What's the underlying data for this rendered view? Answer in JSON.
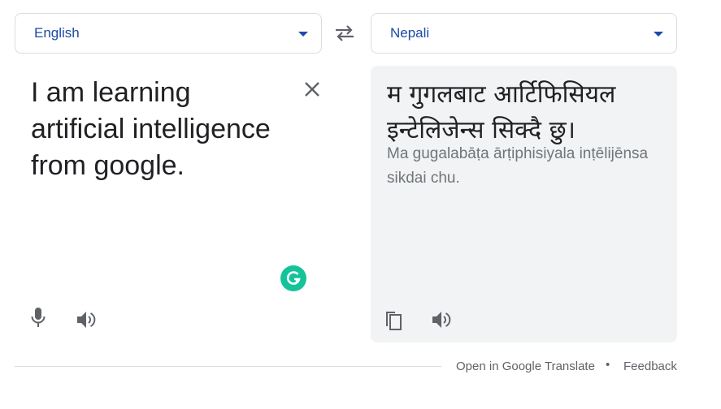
{
  "source": {
    "language": "English",
    "text": "I am learning artificial intelligence from google."
  },
  "target": {
    "language": "Nepali",
    "text": "म गुगलबाट आर्टिफिसियल इन्टेलिजेन्स सिक्दै छु।",
    "transliteration": "Ma gugalabāṭa ārṭiphisiyala inṭēlijēnsa sikdai chu."
  },
  "footer": {
    "open_link": "Open in Google Translate",
    "separator": "•",
    "feedback_link": "Feedback"
  },
  "icons": {
    "swap": "swap-languages-icon",
    "clear": "close-icon",
    "mic": "microphone-icon",
    "listen": "speaker-icon",
    "copy": "copy-icon",
    "grammarly": "grammarly-icon"
  },
  "colors": {
    "accent": "#1a4ba8",
    "grammarly": "#15c39a",
    "panel_bg": "#f1f3f4"
  }
}
